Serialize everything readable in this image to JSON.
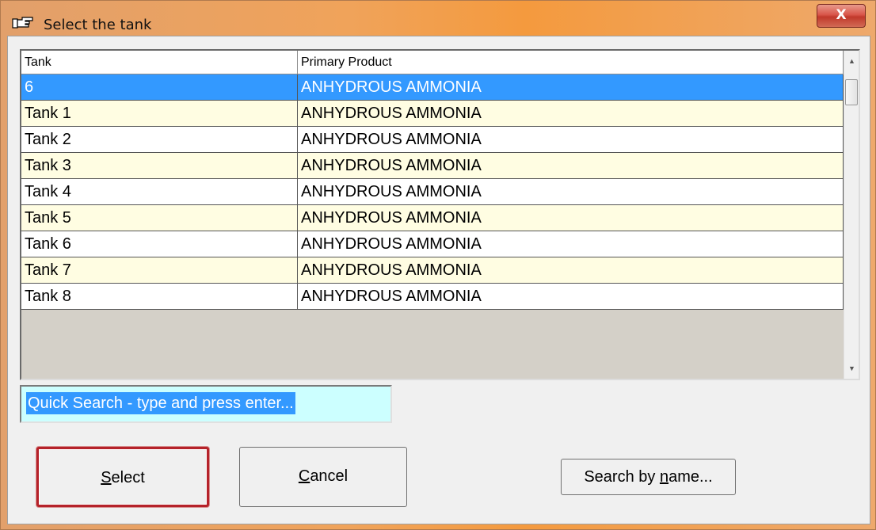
{
  "window": {
    "title": "Select the tank",
    "close_label": "X"
  },
  "grid": {
    "columns": [
      "Tank",
      "Primary Product"
    ],
    "rows": [
      {
        "tank": "6",
        "product": "ANHYDROUS AMMONIA",
        "selected": true
      },
      {
        "tank": "Tank 1",
        "product": "ANHYDROUS AMMONIA"
      },
      {
        "tank": "Tank 2",
        "product": "ANHYDROUS AMMONIA"
      },
      {
        "tank": "Tank 3",
        "product": "ANHYDROUS AMMONIA"
      },
      {
        "tank": "Tank 4",
        "product": "ANHYDROUS AMMONIA"
      },
      {
        "tank": "Tank 5",
        "product": "ANHYDROUS AMMONIA"
      },
      {
        "tank": "Tank 6",
        "product": "ANHYDROUS AMMONIA"
      },
      {
        "tank": "Tank 7",
        "product": "ANHYDROUS AMMONIA"
      },
      {
        "tank": "Tank 8",
        "product": "ANHYDROUS AMMONIA"
      }
    ],
    "selection_color": "#3399ff",
    "alt_row_color": "#fffde2"
  },
  "quick_search": {
    "value": "Quick Search - type and press enter..."
  },
  "buttons": {
    "select_label": "Select",
    "cancel_label": "Cancel",
    "search_by_name_label": "Search by name..."
  },
  "icons": {
    "title": "pointing-hand-icon"
  }
}
